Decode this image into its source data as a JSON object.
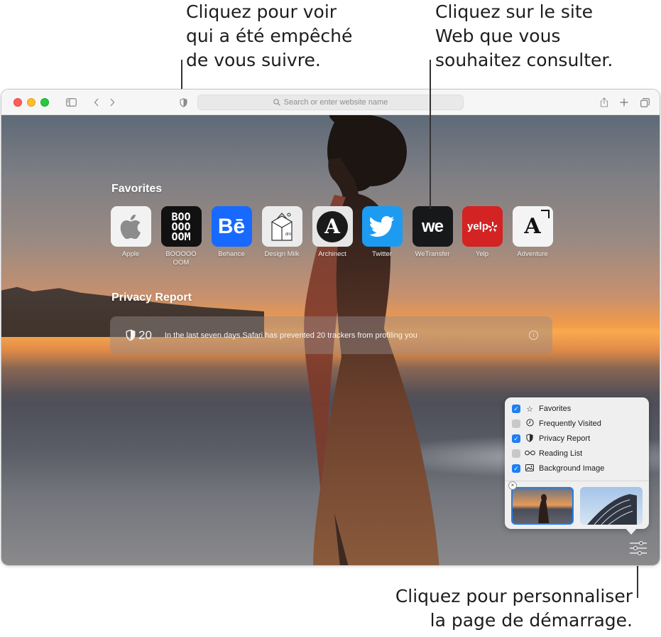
{
  "callouts": {
    "left": [
      "Cliquez pour voir",
      "qui a été empêché",
      "de vous suivre."
    ],
    "right": [
      "Cliquez sur le site",
      "Web que vous",
      "souhaitez consulter."
    ],
    "bottom": [
      "Cliquez pour personnaliser",
      "la page de démarrage."
    ]
  },
  "toolbar": {
    "address_placeholder": "Search or enter website name"
  },
  "favorites": {
    "title": "Favorites",
    "items": [
      {
        "label": "Apple"
      },
      {
        "label": "BOOOOOOOM",
        "tile_text": "BOO OOO OOM"
      },
      {
        "label": "Behance",
        "tile_text": "Bē"
      },
      {
        "label": "Design Milk",
        "tile_text": "dm"
      },
      {
        "label": "Archinect",
        "tile_text": "A"
      },
      {
        "label": "Twitter"
      },
      {
        "label": "WeTransfer",
        "tile_text": "we"
      },
      {
        "label": "Yelp",
        "tile_text": "yelp"
      },
      {
        "label": "Adventure",
        "tile_text": "A"
      }
    ]
  },
  "privacy": {
    "title": "Privacy Report",
    "count": "20",
    "message": "In the last seven days Safari has prevented 20 trackers from profiling you",
    "info": "i"
  },
  "panel": {
    "options": [
      {
        "label": "Favorites",
        "checked": true,
        "icon": "star-icon"
      },
      {
        "label": "Frequently Visited",
        "checked": false,
        "icon": "clock-icon"
      },
      {
        "label": "Privacy Report",
        "checked": true,
        "icon": "shield-icon"
      },
      {
        "label": "Reading List",
        "checked": false,
        "icon": "glasses-icon"
      },
      {
        "label": "Background Image",
        "checked": true,
        "icon": "image-icon"
      }
    ],
    "remove_label": "×"
  },
  "colors": {
    "accent": "#1f7ef5",
    "tile_booooom": "#111111",
    "tile_behance": "#1769ff",
    "tile_twitter": "#1d9bf0",
    "tile_wetransfer": "#17181a",
    "tile_yelp": "#d32323"
  }
}
